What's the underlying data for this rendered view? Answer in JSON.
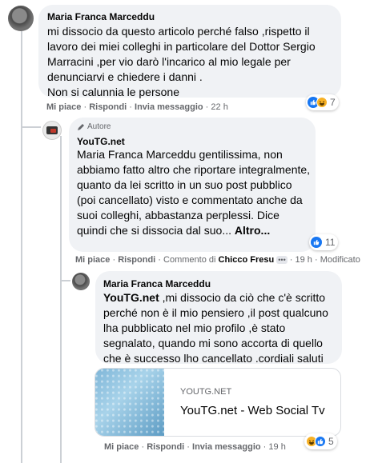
{
  "comments": [
    {
      "author": "Maria Franca Marceddu",
      "text": "mi dissocio da questo articolo perché falso ,rispetto il lavoro dei miei colleghi in particolare del Dottor Sergio Marracini ,per vio darò l'incarico al mio legale per denunciarvi e chiedere i danni .\nNon si calunnia le persone",
      "reactions_count": "7",
      "actions": {
        "like": "Mi piace",
        "reply": "Rispondi",
        "message": "Invia messaggio",
        "time": "22 h"
      }
    },
    {
      "author_badge": "Autore",
      "author": "YouTG.net",
      "text": "Maria Franca Marceddu gentilissima, non abbiamo fatto altro che riportare integralmente, quanto da lei scritto in un suo post pubblico (poi cancellato) visto e commentato anche da suoi colleghi, abbastanza perplessi. Dice quindi che si dissocia dal suo...",
      "more": "Altro...",
      "reactions_count": "11",
      "actions": {
        "like": "Mi piace",
        "reply": "Rispondi",
        "comment_of": "Commento di",
        "commenter": "Chicco Fresu",
        "time": "19 h",
        "edited": "Modificato"
      }
    },
    {
      "author": "Maria Franca Marceddu",
      "mention": "YouTG.net",
      "text": " ,mi dissocio da ciò che c'è scritto perché non è il mio pensiero ,il post qualcuno lha pubblicato nel mio profilo ,è stato segnalato, quando mi sono accorta di quello che è successo lho cancellato .cordiali saluti",
      "link_preview": {
        "domain": "YOUTG.NET",
        "title": "YouTG.net - Web Social Tv"
      },
      "reactions_count": "5",
      "actions": {
        "like": "Mi piace",
        "reply": "Rispondi",
        "message": "Invia messaggio",
        "time": "19 h"
      }
    }
  ],
  "colors": {
    "bubble": "#f0f2f5",
    "like_blue": "#1877f2",
    "haha_yellow": "#f7b125",
    "meta_gray": "#65676b"
  },
  "icons": [
    "pencil-icon",
    "like-reaction-icon",
    "haha-reaction-icon",
    "more-dots-icon"
  ]
}
